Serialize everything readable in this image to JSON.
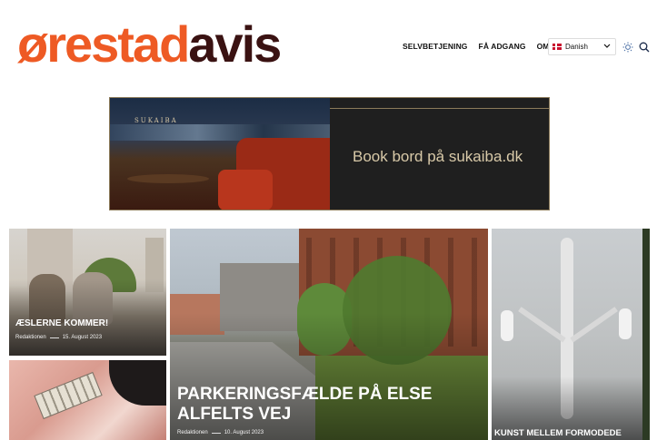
{
  "header": {
    "logo_part1": "ørestad",
    "logo_part2": "avis",
    "nav": [
      "SELVBETJENING",
      "FÅ ADGANG",
      "OM OS"
    ],
    "language": "Danish",
    "icons": [
      "sun-icon",
      "search-icon",
      "denmark-flag-icon",
      "chevron-down-icon"
    ]
  },
  "banner": {
    "brand": "SUKAIBA",
    "text": "Book bord på sukaiba.dk"
  },
  "articles": [
    {
      "title": "ÆSLERNE KOMMER!",
      "author": "Redaktionen",
      "date": "15. August 2023"
    },
    {
      "title": "",
      "author": "",
      "date": ""
    },
    {
      "title": "PARKERINGSFÆLDE PÅ ELSE ALFELTS VEJ",
      "author": "Redaktionen",
      "date": "10. August 2023"
    },
    {
      "title": "KUNST MELLEM FORMODEDE",
      "author": "",
      "date": ""
    }
  ],
  "colors": {
    "brand_orange": "#ee5a24",
    "brand_dark": "#3a1212",
    "banner_gold": "#d8c9a8"
  }
}
